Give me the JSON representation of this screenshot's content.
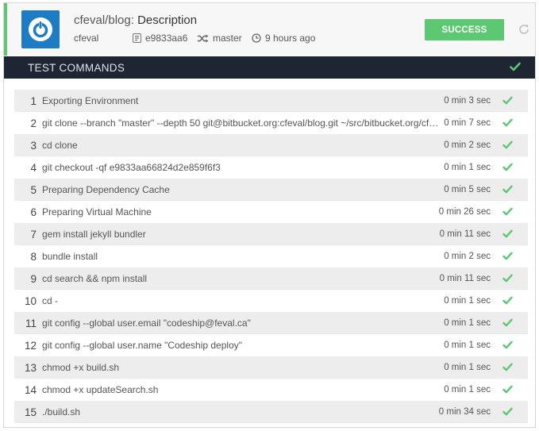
{
  "build": {
    "repo_owner_path": "cfeval/blog:",
    "description": "Description",
    "owner": "cfeval",
    "commit": "e9833aa6",
    "branch": "master",
    "time_ago": "9 hours ago",
    "status_label": "SUCCESS"
  },
  "colors": {
    "success": "#5cc872",
    "section_bar": "#1e2533",
    "avatar": "#1d7cc3"
  },
  "section": {
    "title": "TEST COMMANDS"
  },
  "commands": [
    {
      "num": "1",
      "cmd": "Exporting Environment",
      "duration": "0 min 3 sec"
    },
    {
      "num": "2",
      "cmd": "git clone --branch \"master\" --depth 50 git@bitbucket.org:cfeval/blog.git ~/src/bitbucket.org/cfev...",
      "duration": "0 min 7 sec"
    },
    {
      "num": "3",
      "cmd": "cd clone",
      "duration": "0 min 2 sec"
    },
    {
      "num": "4",
      "cmd": "git checkout -qf e9833aa66824d2e859f6f3",
      "duration": "0 min 1 sec"
    },
    {
      "num": "5",
      "cmd": "Preparing Dependency Cache",
      "duration": "0 min 5 sec"
    },
    {
      "num": "6",
      "cmd": "Preparing Virtual Machine",
      "duration": "0 min 26 sec"
    },
    {
      "num": "7",
      "cmd": "gem install jekyll bundler",
      "duration": "0 min 11 sec"
    },
    {
      "num": "8",
      "cmd": "bundle install",
      "duration": "0 min 2 sec"
    },
    {
      "num": "9",
      "cmd": "cd search && npm install",
      "duration": "0 min 11 sec"
    },
    {
      "num": "10",
      "cmd": "cd -",
      "duration": "0 min 1 sec"
    },
    {
      "num": "11",
      "cmd": "git config --global user.email \"codeship@feval.ca\"",
      "duration": "0 min 1 sec"
    },
    {
      "num": "12",
      "cmd": "git config --global user.name \"Codeship deploy\"",
      "duration": "0 min 1 sec"
    },
    {
      "num": "13",
      "cmd": "chmod +x build.sh",
      "duration": "0 min 1 sec"
    },
    {
      "num": "14",
      "cmd": "chmod +x updateSearch.sh",
      "duration": "0 min 1 sec"
    },
    {
      "num": "15",
      "cmd": "./build.sh",
      "duration": "0 min 34 sec"
    }
  ]
}
